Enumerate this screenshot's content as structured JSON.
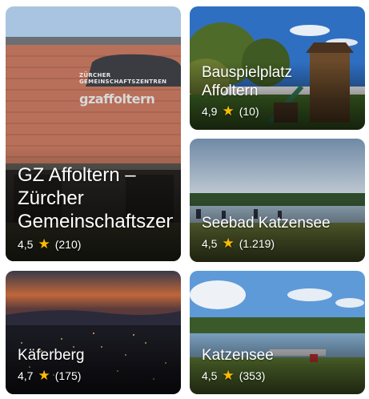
{
  "cards": [
    {
      "title": "GZ Affoltern – Zürcher Gemeinschaftszentren",
      "rating": "4,5",
      "reviews": "(210)",
      "sign_line1": "ZÜRCHER",
      "sign_line2": "GEMEINSCHAFTSZENTREN",
      "sign_logo": "gzaffoltern"
    },
    {
      "title": "Bauspielplatz Affoltern",
      "rating": "4,9",
      "reviews": "(10)"
    },
    {
      "title": "Seebad Katzensee",
      "rating": "4,5",
      "reviews": "(1.219)"
    },
    {
      "title": "Käferberg",
      "rating": "4,7",
      "reviews": "(175)"
    },
    {
      "title": "Katzensee",
      "rating": "4,5",
      "reviews": "(353)"
    }
  ],
  "colors": {
    "star": "#fbbc04",
    "text": "#ffffff"
  },
  "icons": {
    "rating": "star-icon"
  }
}
